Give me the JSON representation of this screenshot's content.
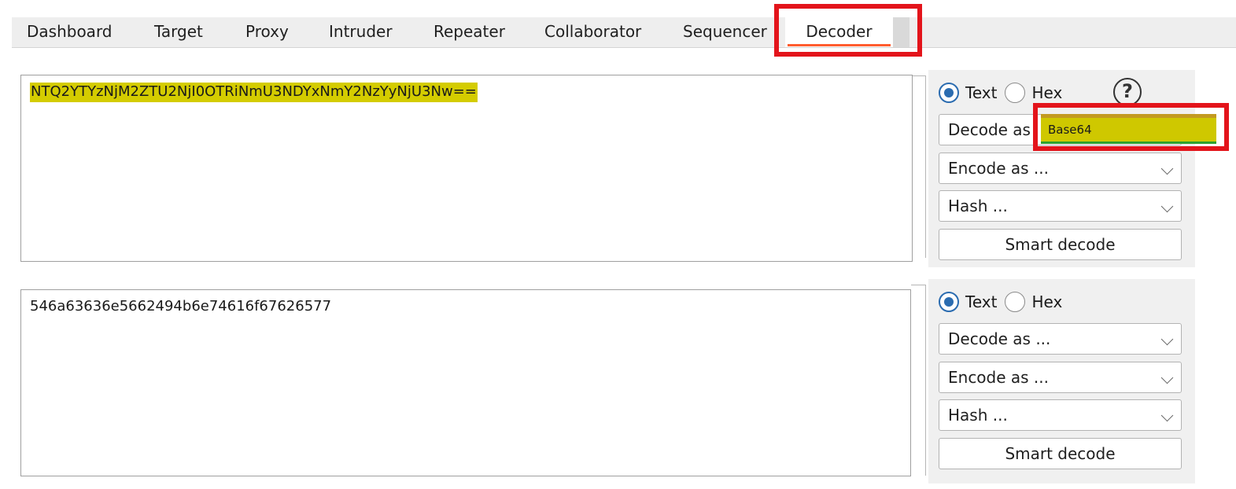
{
  "tabs": [
    {
      "label": "Dashboard",
      "active": false
    },
    {
      "label": "Target",
      "active": false
    },
    {
      "label": "Proxy",
      "active": false
    },
    {
      "label": "Intruder",
      "active": false
    },
    {
      "label": "Repeater",
      "active": false
    },
    {
      "label": "Collaborator",
      "active": false
    },
    {
      "label": "Sequencer",
      "active": false
    },
    {
      "label": "Decoder",
      "active": true
    }
  ],
  "panel1": {
    "input_text": "NTQ2YTYzNjM2ZTU2NjI0OTRiNmU3NDYxNmY2NzYyNjU3Nw==",
    "radio_text": "Text",
    "radio_hex": "Hex",
    "selected_mode": "Text",
    "help_symbol": "?",
    "decode_label": "Decode as",
    "decode_dropdown_value": "Base64",
    "encode_label": "Encode as ...",
    "hash_label": "Hash ...",
    "smart_decode": "Smart decode"
  },
  "panel2": {
    "output_text": "546a63636e5662494b6e74616f67626577",
    "radio_text": "Text",
    "radio_hex": "Hex",
    "selected_mode": "Text",
    "decode_label": "Decode as ...",
    "encode_label": "Encode as ...",
    "hash_label": "Hash ...",
    "smart_decode": "Smart decode"
  },
  "colors": {
    "highlight": "#d4cc00",
    "annotation_red": "#e3141b",
    "active_tab_underline": "#ff5c2e",
    "radio_selected": "#2b6cb0"
  }
}
